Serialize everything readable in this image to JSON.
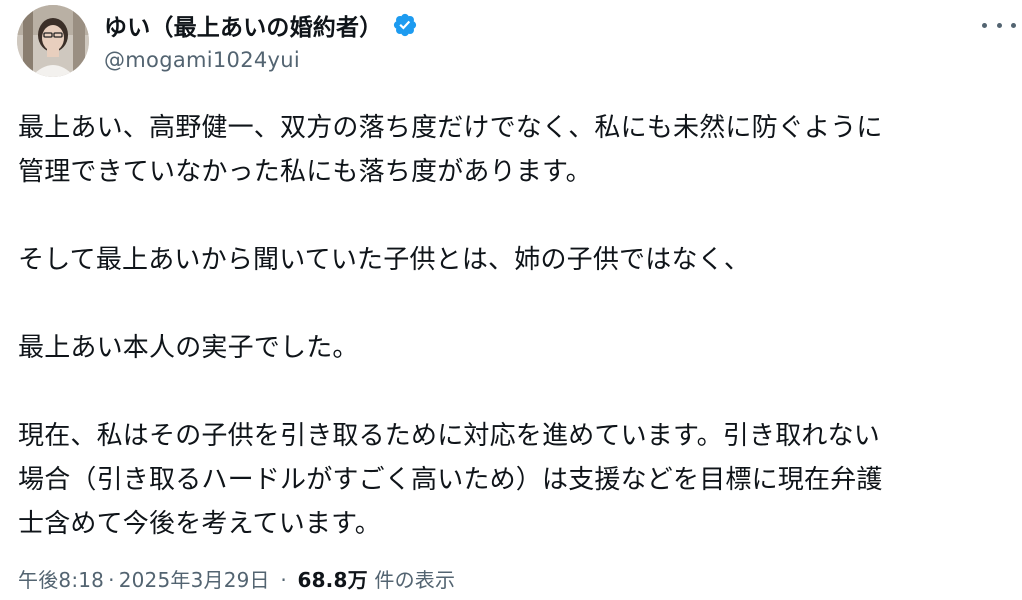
{
  "author": {
    "display_name": "ゆい（最上あいの婚約者）",
    "handle": "@mogami1024yui",
    "verified_color": "#1d9bf0"
  },
  "post": {
    "lines": [
      "最上あい、高野健一、双方の落ち度だけでなく、私にも未然に防ぐように",
      "管理できていなかった私にも落ち度があります。",
      "そして最上あいから聞いていた子供とは、姉の子供ではなく、",
      "最上あい本人の実子でした。",
      "現在、私はその子供を引き取るために対応を進めています。引き取れない",
      "場合（引き取るハードルがすごく高いため）は支援などを目標に現在弁護",
      "士含めて今後を考えています。"
    ]
  },
  "meta": {
    "time": "午後8:18",
    "separator": "·",
    "date": "2025年3月29日",
    "views_count": "68.8万",
    "views_label": "件の表示"
  },
  "icons": {
    "more": "more-horizontal-icon",
    "verified": "verified-badge-icon"
  }
}
